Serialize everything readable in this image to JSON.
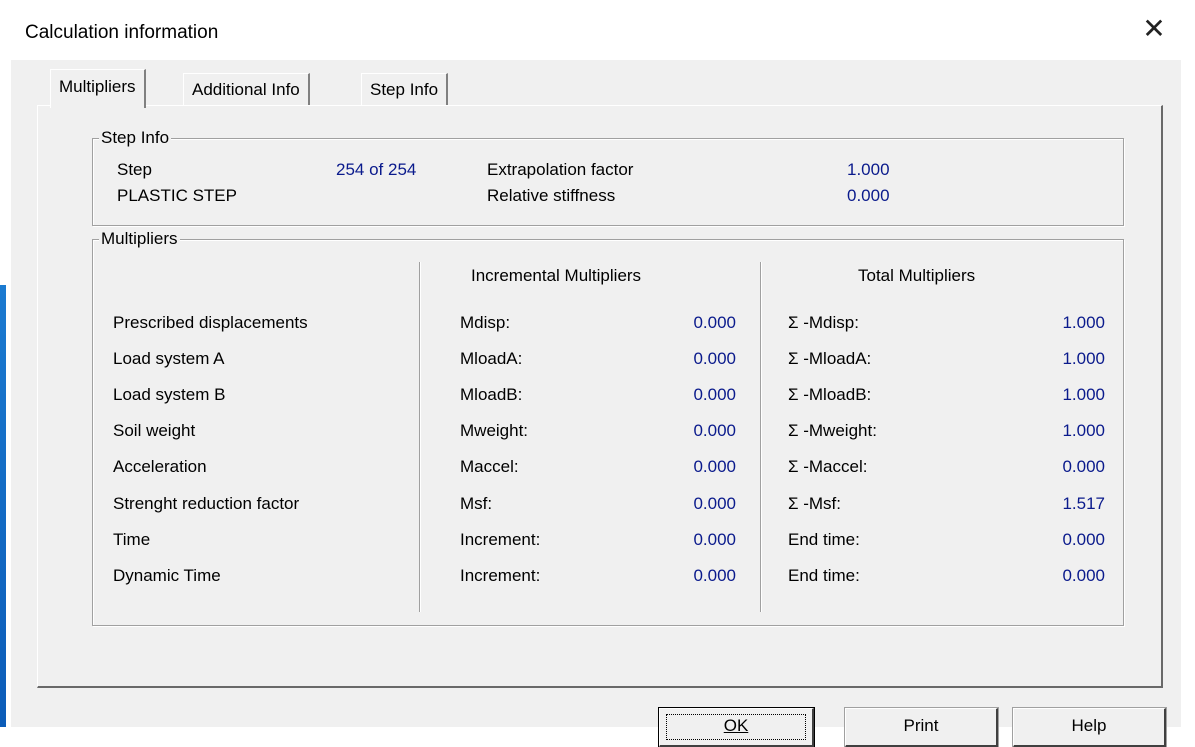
{
  "window": {
    "title": "Calculation information"
  },
  "tabs": [
    {
      "label": "Multipliers",
      "active": true
    },
    {
      "label": "Additional Info",
      "active": false
    },
    {
      "label": "Step Info",
      "active": false
    }
  ],
  "step_info": {
    "legend": "Step Info",
    "step_label": "Step",
    "step_value": "254 of 254",
    "phase": "PLASTIC STEP",
    "extrapolation_label": "Extrapolation factor",
    "extrapolation_value": "1.000",
    "stiffness_label": "Relative stiffness",
    "stiffness_value": "0.000"
  },
  "multipliers": {
    "legend": "Multipliers",
    "incremental_header": "Incremental Multipliers",
    "total_header": "Total Multipliers",
    "rows": [
      {
        "label": "Prescribed displacements",
        "inc_name": "Mdisp:",
        "inc_value": "0.000",
        "tot_name": "Σ -Mdisp:",
        "tot_value": "1.000"
      },
      {
        "label": "Load system A",
        "inc_name": "MloadA:",
        "inc_value": "0.000",
        "tot_name": "Σ -MloadA:",
        "tot_value": "1.000"
      },
      {
        "label": "Load system B",
        "inc_name": "MloadB:",
        "inc_value": "0.000",
        "tot_name": "Σ -MloadB:",
        "tot_value": "1.000"
      },
      {
        "label": "Soil weight",
        "inc_name": "Mweight:",
        "inc_value": "0.000",
        "tot_name": "Σ -Mweight:",
        "tot_value": "1.000"
      },
      {
        "label": "Acceleration",
        "inc_name": "Maccel:",
        "inc_value": "0.000",
        "tot_name": "Σ -Maccel:",
        "tot_value": "0.000"
      },
      {
        "label": "Strenght reduction factor",
        "inc_name": "Msf:",
        "inc_value": "0.000",
        "tot_name": "Σ -Msf:",
        "tot_value": "1.517"
      },
      {
        "label": "Time",
        "inc_name": "Increment:",
        "inc_value": "0.000",
        "tot_name": "End time:",
        "tot_value": "0.000"
      },
      {
        "label": "Dynamic Time",
        "inc_name": "Increment:",
        "inc_value": "0.000",
        "tot_name": "End time:",
        "tot_value": "0.000"
      }
    ]
  },
  "buttons": {
    "ok_label": "OK",
    "print_label": "Print",
    "help_label": "Help"
  },
  "colors": {
    "value_blue": "#0a1a8c",
    "dialog_bg": "#f0f0f0"
  },
  "icons": {
    "close": "close-icon"
  }
}
